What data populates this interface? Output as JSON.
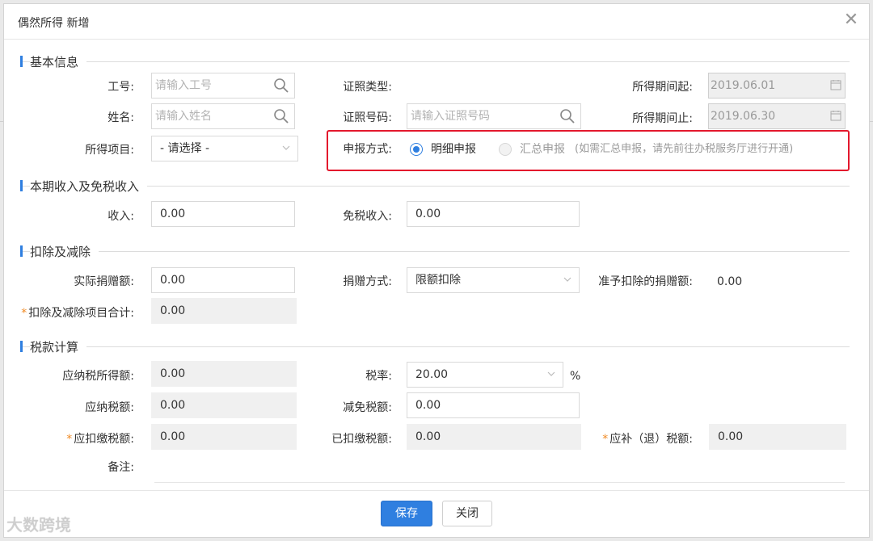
{
  "dialog": {
    "title": "偶然所得 新增",
    "close_glyph": "✕"
  },
  "sections": {
    "basic": "基本信息",
    "income": "本期收入及免税收入",
    "deduction": "扣除及减除",
    "tax": "税款计算"
  },
  "basic": {
    "employee_no_label": "工号:",
    "employee_no_placeholder": "请输入工号",
    "name_label": "姓名:",
    "name_placeholder": "请输入姓名",
    "income_item_label": "所得项目:",
    "income_item_value": "- 请选择 -",
    "id_type_label": "证照类型:",
    "id_no_label": "证照号码:",
    "id_no_placeholder": "请输入证照号码",
    "period_start_label": "所得期间起:",
    "period_start_value": "2019.06.01",
    "period_end_label": "所得期间止:",
    "period_end_value": "2019.06.30",
    "report_mode_label": "申报方式:",
    "report_detail": "明细申报",
    "report_summary": "汇总申报",
    "report_summary_note": "(如需汇总申报，请先前往办税服务厅进行开通)"
  },
  "income": {
    "income_label": "收入:",
    "income_value": "0.00",
    "exempt_label": "免税收入:",
    "exempt_value": "0.00"
  },
  "deduction": {
    "donation_label": "实际捐赠额:",
    "donation_value": "0.00",
    "donation_mode_label": "捐赠方式:",
    "donation_mode_value": "限额扣除",
    "allowed_label": "准予扣除的捐赠额:",
    "allowed_value": "0.00",
    "total_label": "扣除及减除项目合计:",
    "total_value": "0.00"
  },
  "tax": {
    "taxable_label": "应纳税所得额:",
    "taxable_value": "0.00",
    "rate_label": "税率:",
    "rate_value": "20.00",
    "rate_unit": "%",
    "payable_label": "应纳税额:",
    "payable_value": "0.00",
    "relief_label": "减免税额:",
    "relief_value": "0.00",
    "withhold_label": "应扣缴税额:",
    "withhold_value": "0.00",
    "withheld_label": "已扣缴税额:",
    "withheld_value": "0.00",
    "refund_label": "应补（退）税额:",
    "refund_value": "0.00",
    "remark_label": "备注:"
  },
  "required_mark": "*",
  "footer": {
    "save": "保存",
    "close": "关闭"
  },
  "watermark": "大数跨境",
  "colors": {
    "primary": "#2f7fe0",
    "highlight": "#e3182d",
    "required": "#f08a24"
  }
}
